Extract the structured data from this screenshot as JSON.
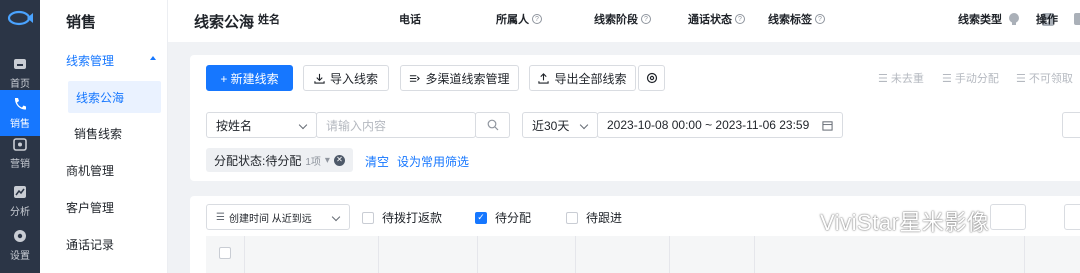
{
  "rail": {
    "items": [
      {
        "label": "首页",
        "icon": "home-icon"
      },
      {
        "label": "销售",
        "icon": "phone-icon",
        "active": true
      },
      {
        "label": "营销",
        "icon": "marketing-icon"
      },
      {
        "label": "分析",
        "icon": "chart-icon"
      },
      {
        "label": "设置",
        "icon": "gear-icon"
      }
    ]
  },
  "subnav": {
    "title": "销售",
    "group": "线索管理",
    "sub_items": [
      "线索公海",
      "销售线索"
    ],
    "items": [
      "商机管理",
      "客户管理",
      "通话记录"
    ]
  },
  "header": {
    "title": "线索公海"
  },
  "toolbar": {
    "new_lead": "+ 新建线索",
    "import": "导入线索",
    "multichannel": "多渠道线索管理",
    "export_all": "导出全部线索",
    "dedupe": "未去重",
    "manual_assign": "手动分配",
    "not_claimable": "不可领取"
  },
  "filters": {
    "field": "按姓名",
    "search_placeholder": "请输入内容",
    "range": "近30天",
    "date_range": "2023-10-08 00:00 ~ 2023-11-06 23:59"
  },
  "active_filter": {
    "label": "分配状态:待分配",
    "count": "1项",
    "clear": "清空",
    "save": "设为常用筛选"
  },
  "list": {
    "sort": "创建时间 从近到远",
    "checks": [
      {
        "label": "待拨打返款",
        "checked": false
      },
      {
        "label": "待分配",
        "checked": true
      },
      {
        "label": "待跟进",
        "checked": false
      }
    ],
    "columns": [
      "姓名",
      "电话",
      "所属人",
      "线索阶段",
      "通话状态",
      "线索标签",
      "线索类型",
      "操作"
    ]
  },
  "watermark": "ViviStar星米影像",
  "colors": {
    "accent": "#1677ff",
    "rail": "#2b3546"
  }
}
